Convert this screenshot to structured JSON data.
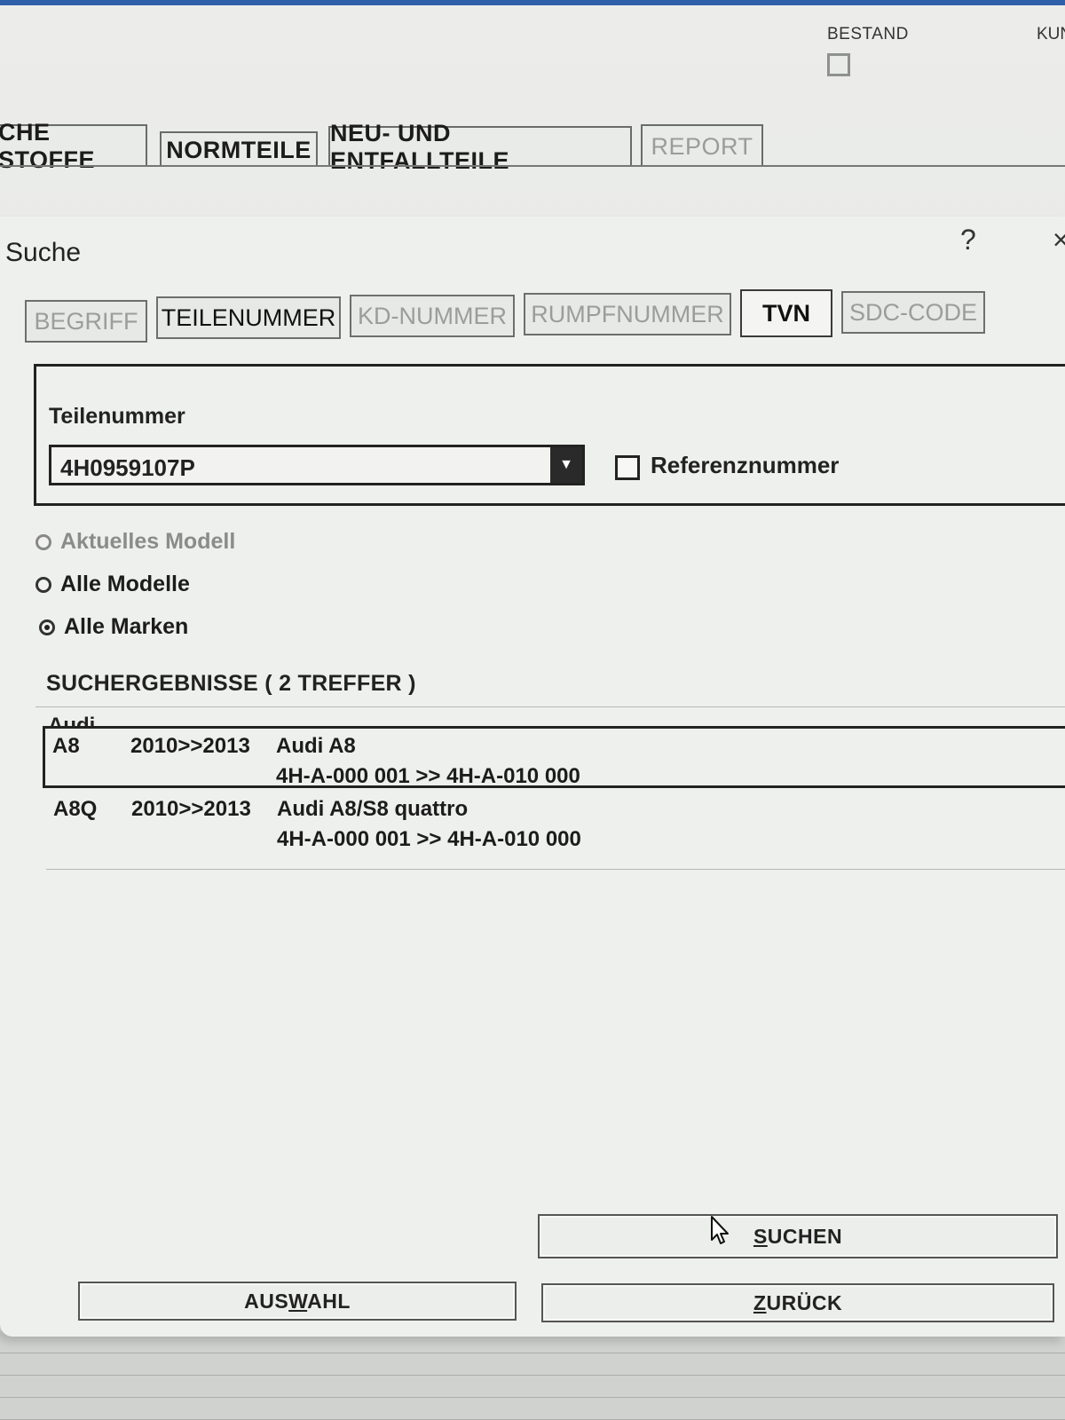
{
  "header": {
    "bestand_label": "BESTAND",
    "kun_label": "KUN"
  },
  "main_tabs": [
    {
      "label": "CHE STOFFE"
    },
    {
      "label": "NORMTEILE"
    },
    {
      "label": "NEU- UND ENTFALLTEILE"
    },
    {
      "label": "REPORT"
    }
  ],
  "dialog": {
    "title": "Suche",
    "help": "?",
    "close": "×"
  },
  "search_tabs": [
    {
      "label": "BEGRIFF"
    },
    {
      "label": "TEILENUMMER"
    },
    {
      "label": "KD-NUMMER"
    },
    {
      "label": "RUMPFNUMMER"
    },
    {
      "label": "TVN"
    },
    {
      "label": "SDC-CODE"
    }
  ],
  "search": {
    "field_label": "Teilenummer",
    "value": "4H0959107P",
    "reference_label": "Referenznummer",
    "reference_checked": false
  },
  "scope": [
    {
      "label": "Aktuelles Modell",
      "checked": false,
      "enabled": false
    },
    {
      "label": "Alle Modelle",
      "checked": false,
      "enabled": true
    },
    {
      "label": "Alle Marken",
      "checked": true,
      "enabled": true
    }
  ],
  "results": {
    "title": "SUCHERGEBNISSE  ( 2 TREFFER )",
    "group": "Audi",
    "rows": [
      {
        "model": "A8",
        "years": "2010>>2013",
        "name": "Audi A8",
        "range": "4H-A-000 001 >> 4H-A-010 000",
        "selected": true
      },
      {
        "model": "A8Q",
        "years": "2010>>2013",
        "name": "Audi A8/S8 quattro",
        "range": "4H-A-000 001 >> 4H-A-010 000",
        "selected": false
      }
    ]
  },
  "buttons": {
    "suchen": {
      "pre": "",
      "key": "S",
      "post": "UCHEN"
    },
    "auswahl": {
      "pre": "AUS",
      "key": "W",
      "post": "AHL"
    },
    "zurueck": {
      "pre": "",
      "key": "Z",
      "post": "URÜCK"
    }
  },
  "icons": {
    "dropdown": "chevron-down-icon",
    "cursor": "mouse-pointer-icon"
  }
}
